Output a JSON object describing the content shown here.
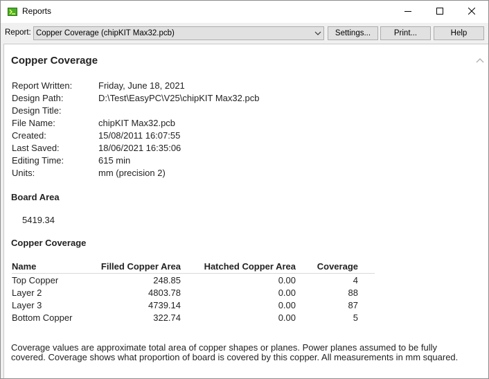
{
  "window": {
    "title": "Reports",
    "icon": "easypc-app-icon",
    "controls": [
      "minimize-icon",
      "maximize-icon",
      "close-icon"
    ]
  },
  "toolbar": {
    "report_label": "Report:",
    "report_selected": "Copper Coverage (chipKIT Max32.pcb)",
    "settings_label": "Settings...",
    "print_label": "Print...",
    "help_label": "Help"
  },
  "report": {
    "title": "Copper Coverage",
    "info": [
      {
        "label": "Report Written:",
        "value": "Friday, June 18, 2021"
      },
      {
        "label": "Design Path:",
        "value": "D:\\Test\\EasyPC\\V25\\chipKIT Max32.pcb"
      },
      {
        "label": "Design Title:",
        "value": ""
      },
      {
        "label": "File Name:",
        "value": "chipKIT Max32.pcb"
      },
      {
        "label": "Created:",
        "value": "15/08/2011 16:07:55"
      },
      {
        "label": "Last Saved:",
        "value": "18/06/2021 16:35:06"
      },
      {
        "label": "Editing Time:",
        "value": "615 min"
      },
      {
        "label": "Units:",
        "value": "mm (precision 2)"
      }
    ],
    "board_area_heading": "Board Area",
    "board_area_value": "5419.34",
    "coverage_heading": "Copper Coverage",
    "table": {
      "headers": [
        "Name",
        "Filled Copper Area",
        "Hatched Copper Area",
        "Coverage"
      ],
      "rows": [
        [
          "Top Copper",
          "248.85",
          "0.00",
          "4"
        ],
        [
          "Layer 2",
          "4803.78",
          "0.00",
          "88"
        ],
        [
          "Layer 3",
          "4739.14",
          "0.00",
          "87"
        ],
        [
          "Bottom Copper",
          "322.74",
          "0.00",
          "5"
        ]
      ]
    },
    "note": "Coverage values are approximate total area of copper shapes or planes. Power planes assumed to be fully covered. Coverage shows what proportion of board is covered by this copper. All measurements in mm squared."
  },
  "colors": {
    "titlebar": "#ffffff",
    "toolbar": "#f0f0f0",
    "button_face": "#e1e1e1",
    "app_icon_green": "#4caf2a",
    "content_bg": "#ffffff"
  }
}
